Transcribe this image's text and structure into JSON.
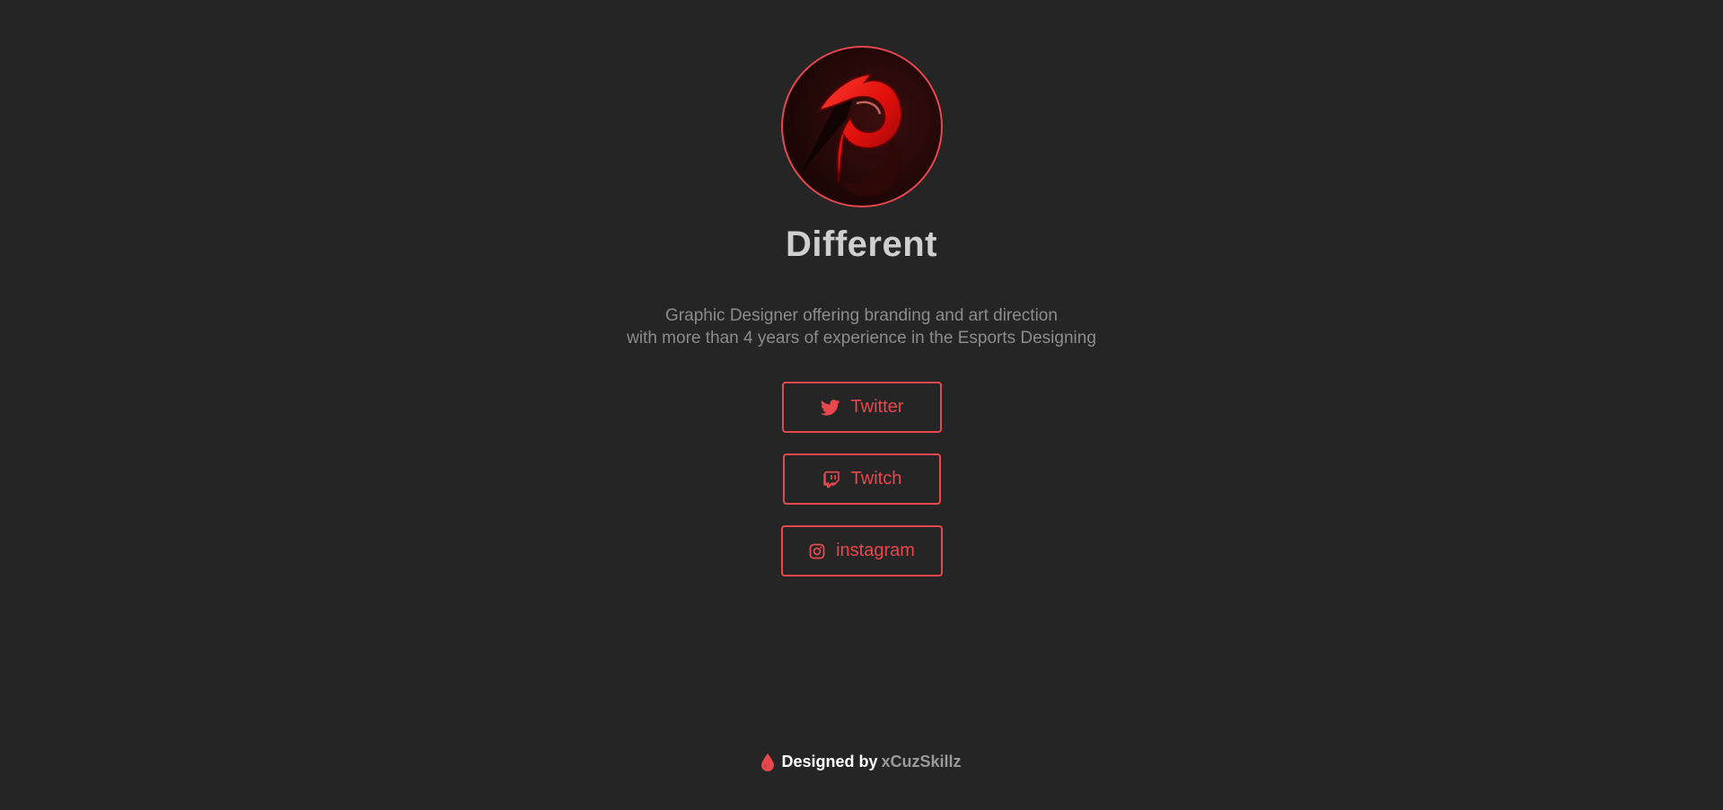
{
  "profile": {
    "name": "Different",
    "bio_line1": "Graphic Designer offering branding and art direction",
    "bio_line2": "with more than 4 years of experience in the Esports Designing",
    "avatar_icon": "red-flame-d-logo"
  },
  "links": [
    {
      "label": "Twitter",
      "icon": "twitter-icon"
    },
    {
      "label": "Twitch",
      "icon": "twitch-icon"
    },
    {
      "label": "instagram",
      "icon": "instagram-icon"
    }
  ],
  "footer": {
    "designed_by": "Designed by",
    "author": "xCuzSkillz",
    "icon": "drop-icon"
  },
  "colors": {
    "background": "#252525",
    "accent": "#e8474e",
    "title": "#cfcfcf",
    "bio": "#8c8c8c"
  }
}
